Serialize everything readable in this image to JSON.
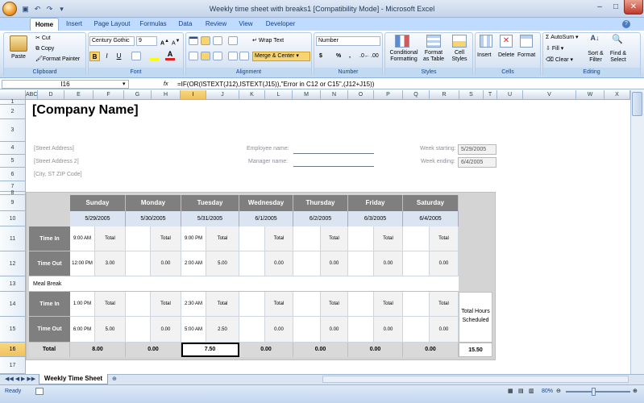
{
  "window": {
    "title": "Weekly time sheet with breaks1  [Compatibility Mode] - Microsoft Excel"
  },
  "tabs": [
    "Home",
    "Insert",
    "Page Layout",
    "Formulas",
    "Data",
    "Review",
    "View",
    "Developer"
  ],
  "clipboard": {
    "paste": "Paste",
    "cut": "Cut",
    "copy": "Copy",
    "format_painter": "Format Painter",
    "label": "Clipboard"
  },
  "font": {
    "name": "Century Gothic",
    "size": "9",
    "bold": "B",
    "italic": "I",
    "underline": "U",
    "label": "Font"
  },
  "alignment": {
    "wrap": "Wrap Text",
    "merge": "Merge & Center",
    "label": "Alignment"
  },
  "number": {
    "format": "Number",
    "currency": "$",
    "percent": "%",
    "comma": ",",
    "label": "Number"
  },
  "styles": {
    "conditional": "Conditional",
    "conditional2": "Formatting",
    "format_table": "Format",
    "format_table2": "as Table",
    "cell_styles": "Cell",
    "cell_styles2": "Styles",
    "label": "Styles"
  },
  "cells": {
    "insert": "Insert",
    "delete": "Delete",
    "format": "Format",
    "label": "Cells"
  },
  "editing": {
    "autosum": "AutoSum",
    "fill": "Fill",
    "clear": "Clear",
    "sort": "Sort &",
    "sort2": "Filter",
    "find": "Find &",
    "find2": "Select",
    "label": "Editing"
  },
  "formula_bar": {
    "name_box": "I16",
    "fx": "fx",
    "formula": "=IF(OR(ISTEXT(J12),ISTEXT(J15)),\"Error in C12 or C15\",(J12+J15))"
  },
  "columns": [
    "ABC",
    "D",
    "E",
    "F",
    "G",
    "H",
    "I",
    "J",
    "K",
    "L",
    "M",
    "N",
    "O",
    "P",
    "Q",
    "R",
    "S",
    "T",
    "U",
    "V",
    "W",
    "X"
  ],
  "rows": [
    "1",
    "2",
    "3",
    "4",
    "5",
    "6",
    "7",
    "8",
    "9",
    "10",
    "11",
    "12",
    "13",
    "14",
    "15",
    "16",
    "17"
  ],
  "sheet": {
    "company": "[Company Name]",
    "address1": "[Street Address]",
    "address2": "[Street Address 2]",
    "city": "[City, ST  ZIP Code]",
    "employee_label": "Employee name:",
    "manager_label": "Manager name:",
    "week_start_label": "Week starting:",
    "week_start": "5/29/2005",
    "week_end_label": "Week ending:",
    "week_end": "6/4/2005",
    "days": [
      "Sunday",
      "Monday",
      "Tuesday",
      "Wednesday",
      "Thursday",
      "Friday",
      "Saturday"
    ],
    "dates": [
      "5/29/2005",
      "5/30/2005",
      "5/31/2005",
      "6/1/2005",
      "6/2/2005",
      "6/3/2005",
      "6/4/2005"
    ],
    "time_in": "Time In",
    "time_out": "Time Out",
    "meal_break": "Meal Break",
    "total_label": "Total",
    "total_word": "Total",
    "in1": [
      "9:00 AM",
      "",
      "9:00 PM",
      "",
      "",
      "",
      ""
    ],
    "out1": [
      "12:00 PM",
      "",
      "2:00 AM",
      "",
      "",
      "",
      ""
    ],
    "tot1": [
      "3.00",
      "0.00",
      "5.00",
      "0.00",
      "0.00",
      "0.00",
      "0.00"
    ],
    "in2": [
      "1:00 PM",
      "",
      "2:30 AM",
      "",
      "",
      "",
      ""
    ],
    "out2": [
      "6:00 PM",
      "",
      "5:00 AM",
      "",
      "",
      "",
      ""
    ],
    "tot2": [
      "5.00",
      "0.00",
      "2.50",
      "0.00",
      "0.00",
      "0.00",
      "0.00"
    ],
    "day_totals": [
      "8.00",
      "0.00",
      "7.50",
      "0.00",
      "0.00",
      "0.00",
      "0.00"
    ],
    "total_hours_label1": "Total Hours",
    "total_hours_label2": "Scheduled",
    "grand_total": "15.50"
  },
  "sheet_tab": "Weekly Time Sheet",
  "status": {
    "ready": "Ready",
    "zoom": "80%"
  }
}
